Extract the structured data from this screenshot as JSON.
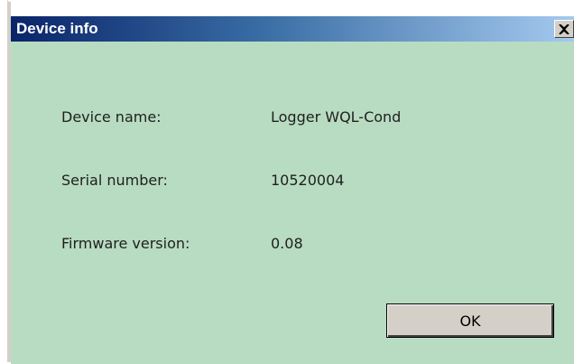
{
  "window": {
    "title": "Device info",
    "close_icon": "close-icon"
  },
  "fields": {
    "device_name_label": "Device name:",
    "device_name_value": "Logger WQL-Cond",
    "serial_number_label": "Serial number:",
    "serial_number_value": "10520004",
    "firmware_version_label": "Firmware version:",
    "firmware_version_value": "0.08"
  },
  "buttons": {
    "ok_label": "OK"
  },
  "colors": {
    "title_bar_start": "#0a246a",
    "title_bar_end": "#a6caf0",
    "client_background": "#b8dcc1",
    "button_face": "#d4d0c8"
  }
}
